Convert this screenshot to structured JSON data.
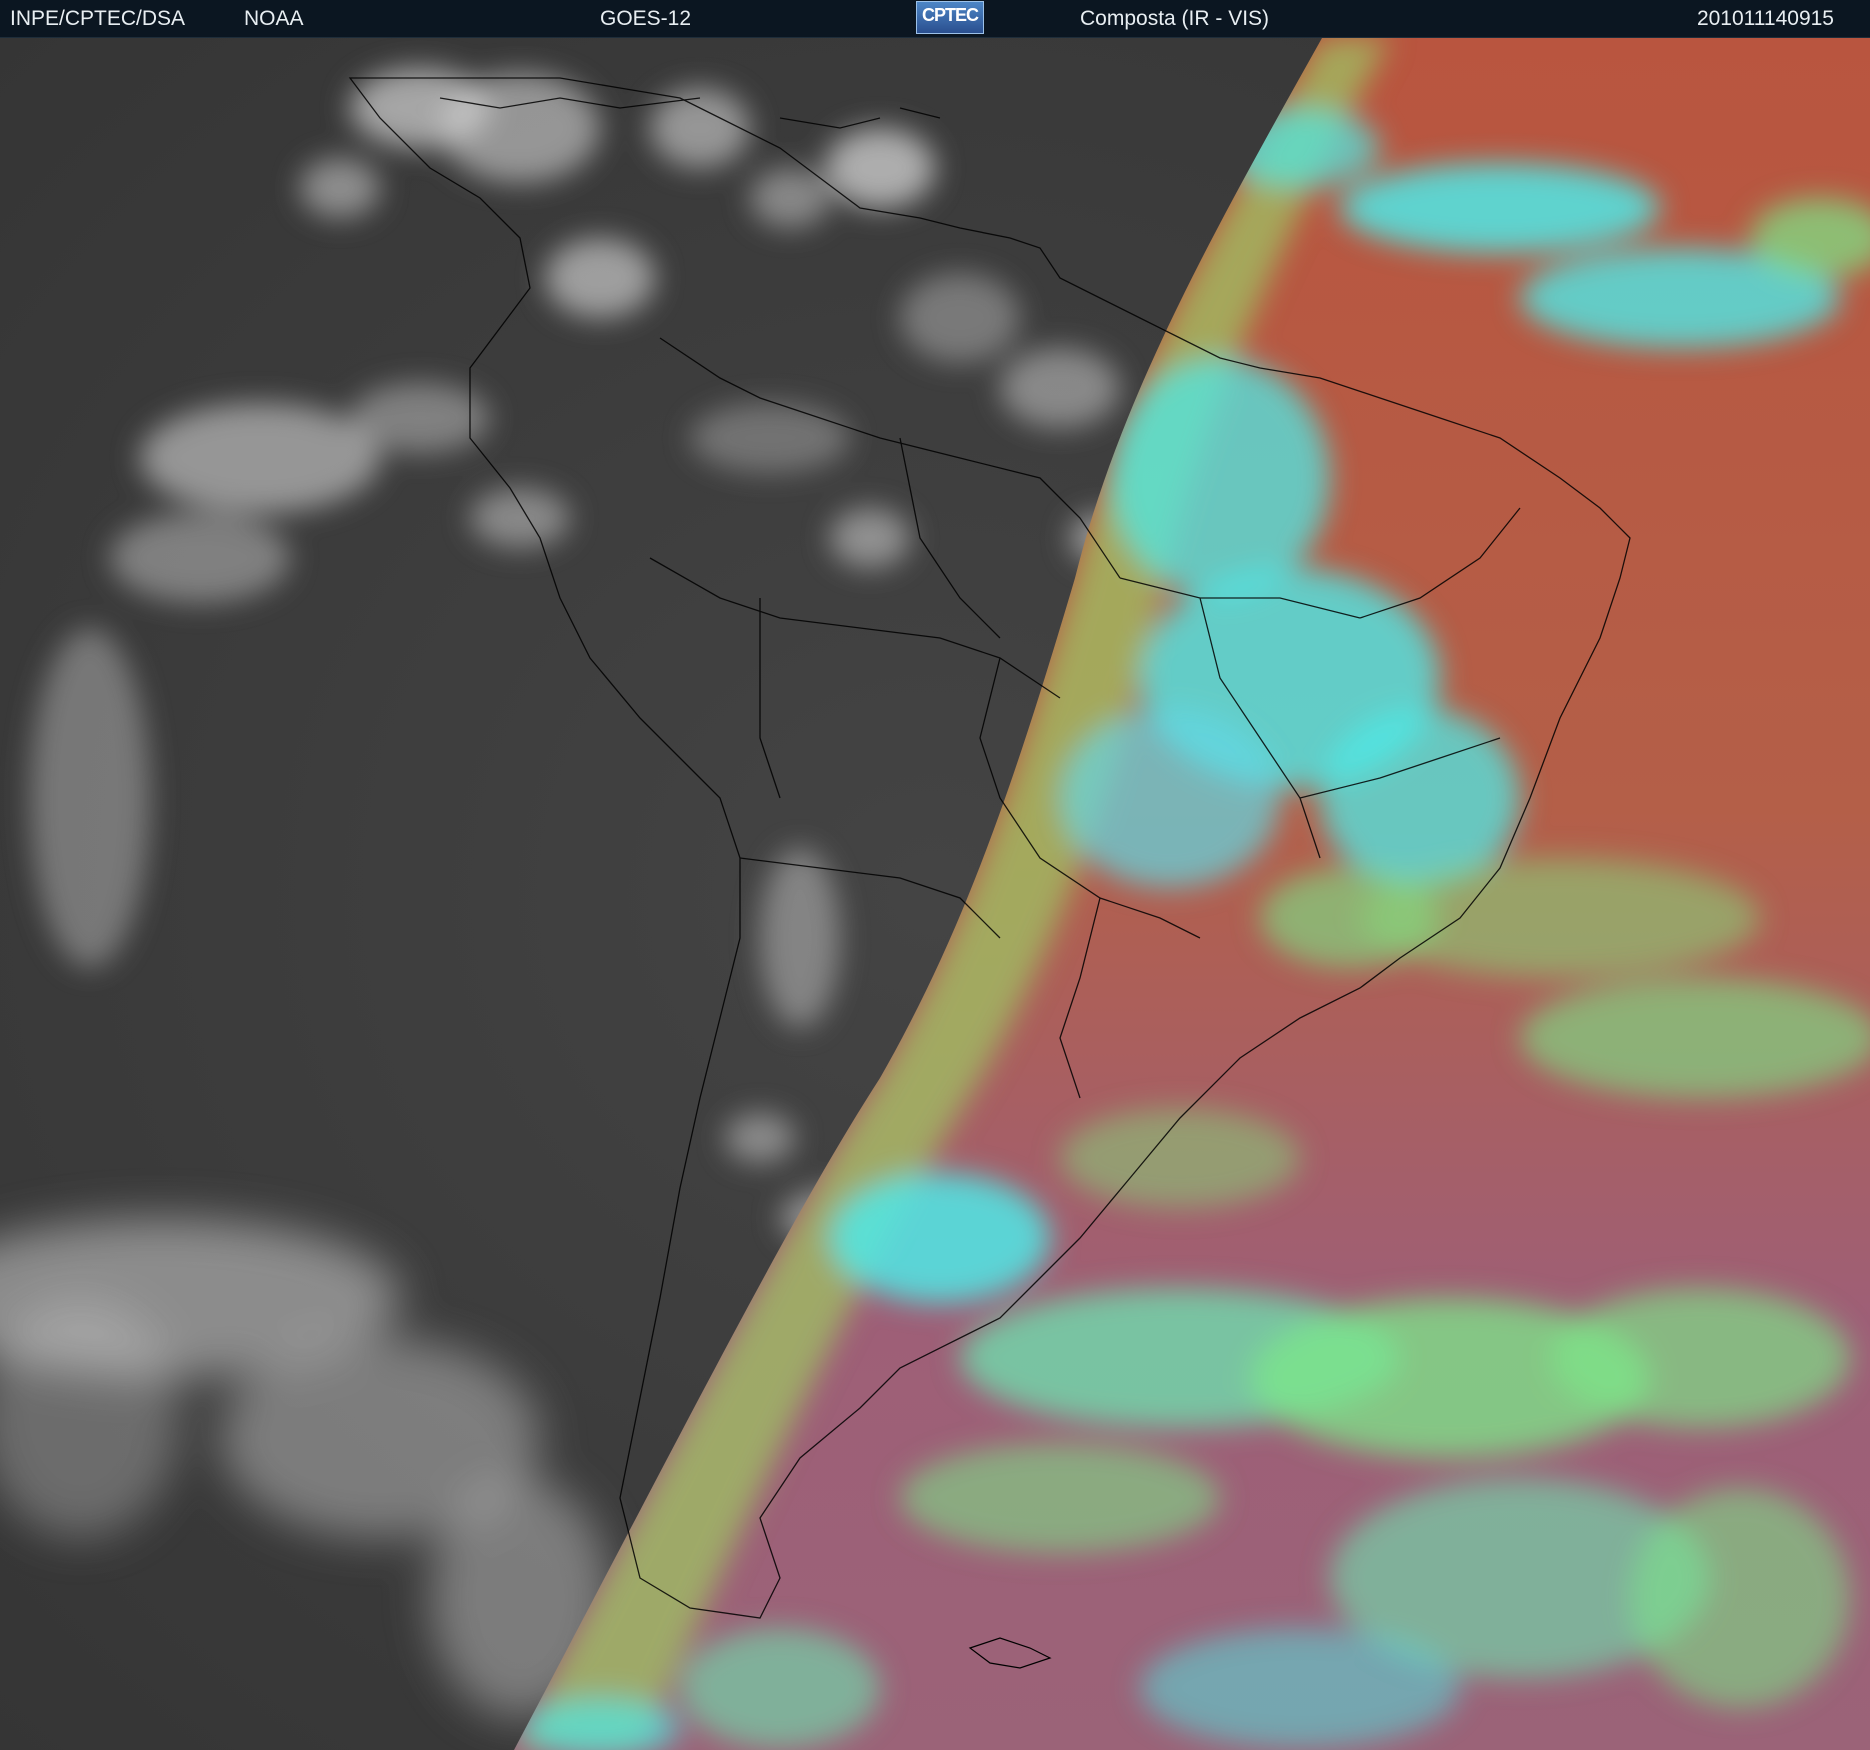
{
  "header": {
    "organization": "INPE/CPTEC/DSA",
    "agency": "NOAA",
    "satellite": "GOES-12",
    "logo_text": "CPTEC",
    "product": "Composta (IR - VIS)",
    "timestamp": "201011140915"
  },
  "colors": {
    "header_background": "#0b1621",
    "ir_background": "#3c3c3c",
    "ir_clouds": "#d8d8d8",
    "vis_clear_sea": "#b5574a",
    "vis_clouds_cyan": "#4fe9e7",
    "vis_clouds_green": "#7ce889",
    "vis_purple": "#9b5f7c",
    "coastline": "#000000"
  },
  "map": {
    "region": "South America",
    "left_panel": "IR grayscale (night side)",
    "right_panel": "VIS color composite (day side)"
  }
}
